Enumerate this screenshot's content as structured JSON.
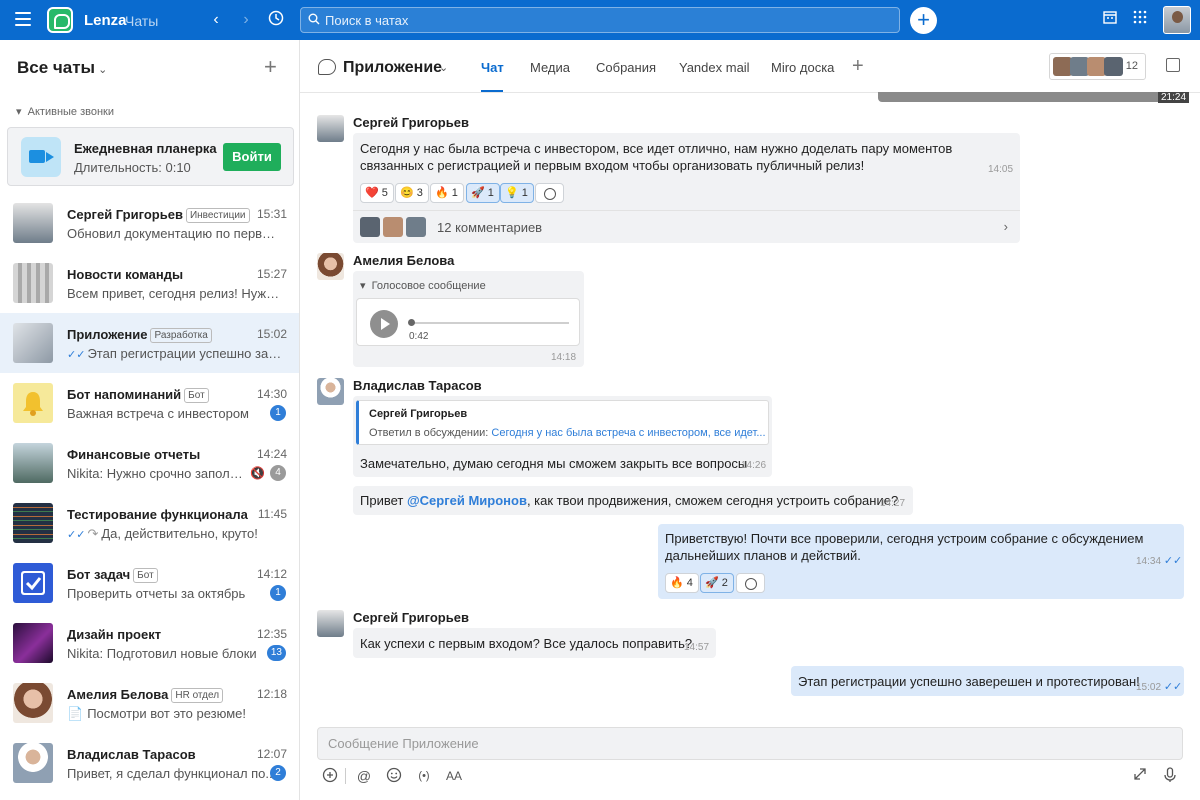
{
  "topbar": {
    "brand": "Lenza",
    "subtitle": "Чаты",
    "search_placeholder": "Поиск в чатах"
  },
  "sidebar": {
    "header": "Все чаты",
    "active_calls_label": "Активные звонки",
    "call": {
      "title": "Ежедневная планерка",
      "duration": "Длительность: 0:10",
      "join_label": "Войти"
    },
    "chats": [
      {
        "name": "Сергей Григорьев",
        "tag": "Инвестиции",
        "time": "15:31",
        "last": "Обновил документацию по первом...",
        "badge": "",
        "ava_color": "#6f7d8a"
      },
      {
        "name": "Новости команды",
        "tag": "",
        "time": "15:27",
        "last": "Всем привет, сегодня релиз! Нужно...",
        "badge": "",
        "ava_color": "#b9b9b9"
      },
      {
        "name": "Приложение",
        "tag": "Разработка",
        "time": "15:02",
        "last": "Этап регистрации успешно заве...",
        "badge": "",
        "ava_color": "#a8b1bb"
      },
      {
        "name": "Бот напоминаний",
        "tag": "Бот",
        "time": "14:30",
        "last": "Важная встреча с инвестором",
        "badge": "1",
        "ava_color": "#f6e99a"
      },
      {
        "name": "Финансовые отчеты",
        "tag": "",
        "time": "14:24",
        "last": "Nikita: Нужно срочно заполн...",
        "badge": "4",
        "ava_color": "#6f8a86"
      },
      {
        "name": "Тестирование функционала",
        "tag": "",
        "time": "11:45",
        "last": "Да, действительно, круто!",
        "badge": "",
        "ava_color": "#233044"
      },
      {
        "name": "Бот задач",
        "tag": "Бот",
        "time": "14:12",
        "last": "Проверить отчеты за октябрь",
        "badge": "1",
        "ava_color": "#2f5bd6"
      },
      {
        "name": "Дизайн проект",
        "tag": "",
        "time": "12:35",
        "last": "Nikita: Подготовил новые блоки",
        "badge": "13",
        "ava_color": "#4a1a5e"
      },
      {
        "name": "Амелия Белова",
        "tag": "HR отдел",
        "time": "12:18",
        "last": "Посмотри вот это резюме!",
        "badge": "",
        "ava_color": "#c79f86"
      },
      {
        "name": "Владислав Тарасов",
        "tag": "",
        "time": "12:07",
        "last": "Привет, я сделал функционал по...",
        "badge": "2",
        "ava_color": "#9fa8b2"
      }
    ]
  },
  "chat_header": {
    "title": "Приложение",
    "tabs": [
      "Чат",
      "Медиа",
      "Собрания",
      "Yandex mail",
      "Miro доска"
    ],
    "member_count": "12",
    "image_time": "21:24"
  },
  "messages": {
    "m1": {
      "author": "Сергей Григорьев",
      "text_1": "Сегодня у нас была встреча с инвестором, все идет отлично, нам нужно доделать пару моментов",
      "text_2": "связанных с регистрацией и первым входом чтобы организовать публичный релиз!",
      "time": "14:05",
      "reactions": [
        {
          "emoji": "❤️",
          "count": "5"
        },
        {
          "emoji": "😊",
          "count": "3"
        },
        {
          "emoji": "🔥",
          "count": "1"
        },
        {
          "emoji": "🚀",
          "count": "1"
        },
        {
          "emoji": "💡",
          "count": "1"
        }
      ],
      "comments": "12 комментариев"
    },
    "m2": {
      "author": "Амелия Белова",
      "voice_label": "Голосовое сообщение",
      "voice_length": "0:42",
      "time": "14:18"
    },
    "m3": {
      "author": "Владислав Тарасов",
      "quote_author": "Сергей Григорьев",
      "quote_prefix": "Ответил в обсуждении: ",
      "quote_link": "Сегодня у нас была встреча с инвестором, все идет...",
      "text": "Замечательно, думаю сегодня мы сможем закрыть все вопросы",
      "time": "14:26"
    },
    "m4": {
      "prefix": "Привет ",
      "mention": "@Сергей Миронов",
      "suffix": ", как твои продвижения, сможем сегодня устроить собрание?",
      "time": "14:27"
    },
    "m5": {
      "text_1": "Приветствую! Почти все проверили, сегодня устроим собрание с обсуждением",
      "text_2": "дальнейших планов и действий.",
      "time": "14:34",
      "reactions": [
        {
          "emoji": "🔥",
          "count": "4"
        },
        {
          "emoji": "🚀",
          "count": "2"
        }
      ]
    },
    "m6": {
      "author": "Сергей Григорьев",
      "text": "Как успехи с первым входом? Все удалось поправить?",
      "time": "14:57"
    },
    "m7": {
      "text": "Этап регистрации успешно заверешен и протестирован!",
      "time": "15:02"
    }
  },
  "composer": {
    "placeholder": "Сообщение Приложение"
  }
}
